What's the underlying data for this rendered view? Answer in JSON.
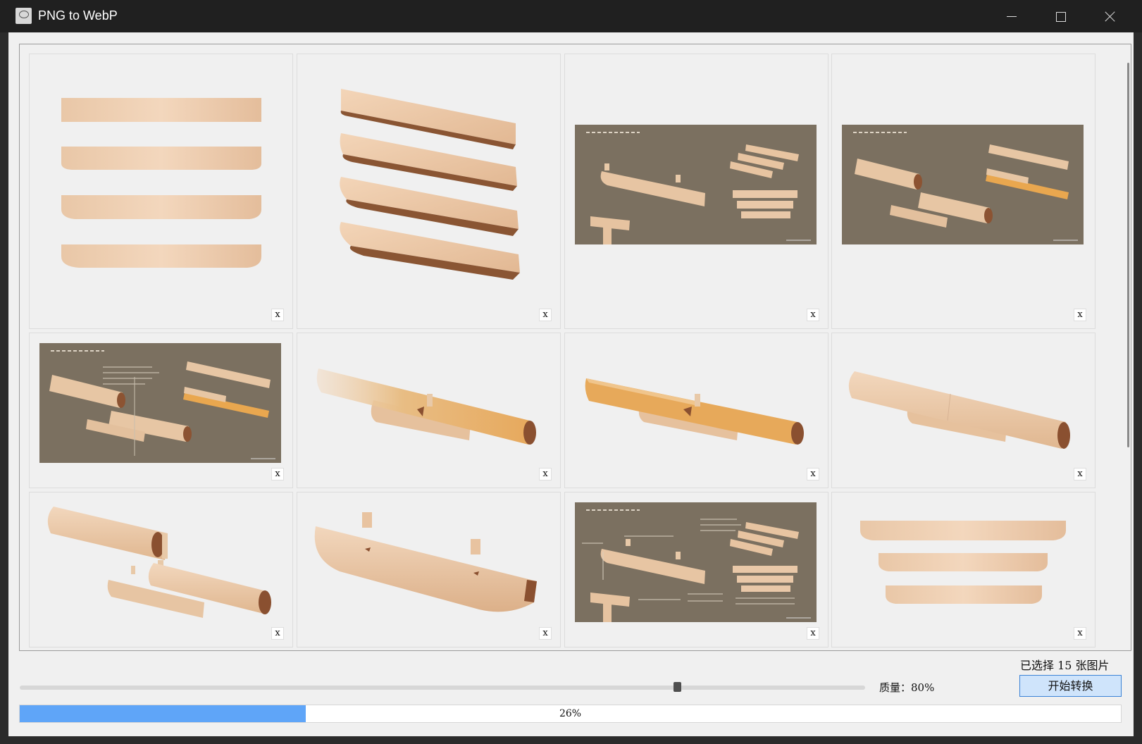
{
  "window": {
    "title": "PNG to WebP",
    "icons": [
      "app-icon",
      "minimize-icon",
      "maximize-icon",
      "close-icon"
    ]
  },
  "gallery": {
    "remove_label": "x",
    "items": [
      {
        "scene": "four-stacked-boards-front"
      },
      {
        "scene": "four-stacked-boards-angled"
      },
      {
        "scene": "brown-diagram-beam-parts"
      },
      {
        "scene": "brown-diagram-cylinders"
      },
      {
        "scene": "brown-diagram-annotated-cylinders"
      },
      {
        "scene": "beam-joint-transparent"
      },
      {
        "scene": "beam-joint-orange"
      },
      {
        "scene": "round-beam-assembled"
      },
      {
        "scene": "round-beam-exploded"
      },
      {
        "scene": "bracket-with-pegs"
      },
      {
        "scene": "brown-diagram-dimensioned"
      },
      {
        "scene": "three-stacked-boards"
      }
    ]
  },
  "status": {
    "selected": "已选择 15 张图片"
  },
  "controls": {
    "quality_label": "质量：80%",
    "quality_value": 0.8,
    "start_button": "开始转换"
  },
  "progress": {
    "value": 0.26,
    "label": "26%"
  },
  "colors": {
    "accent": "#5fa5f8",
    "button_bg": "#cfe4fb",
    "button_border": "#3b83d6",
    "wood": "#e7c7a6",
    "diagram_bg": "#7b7060"
  }
}
